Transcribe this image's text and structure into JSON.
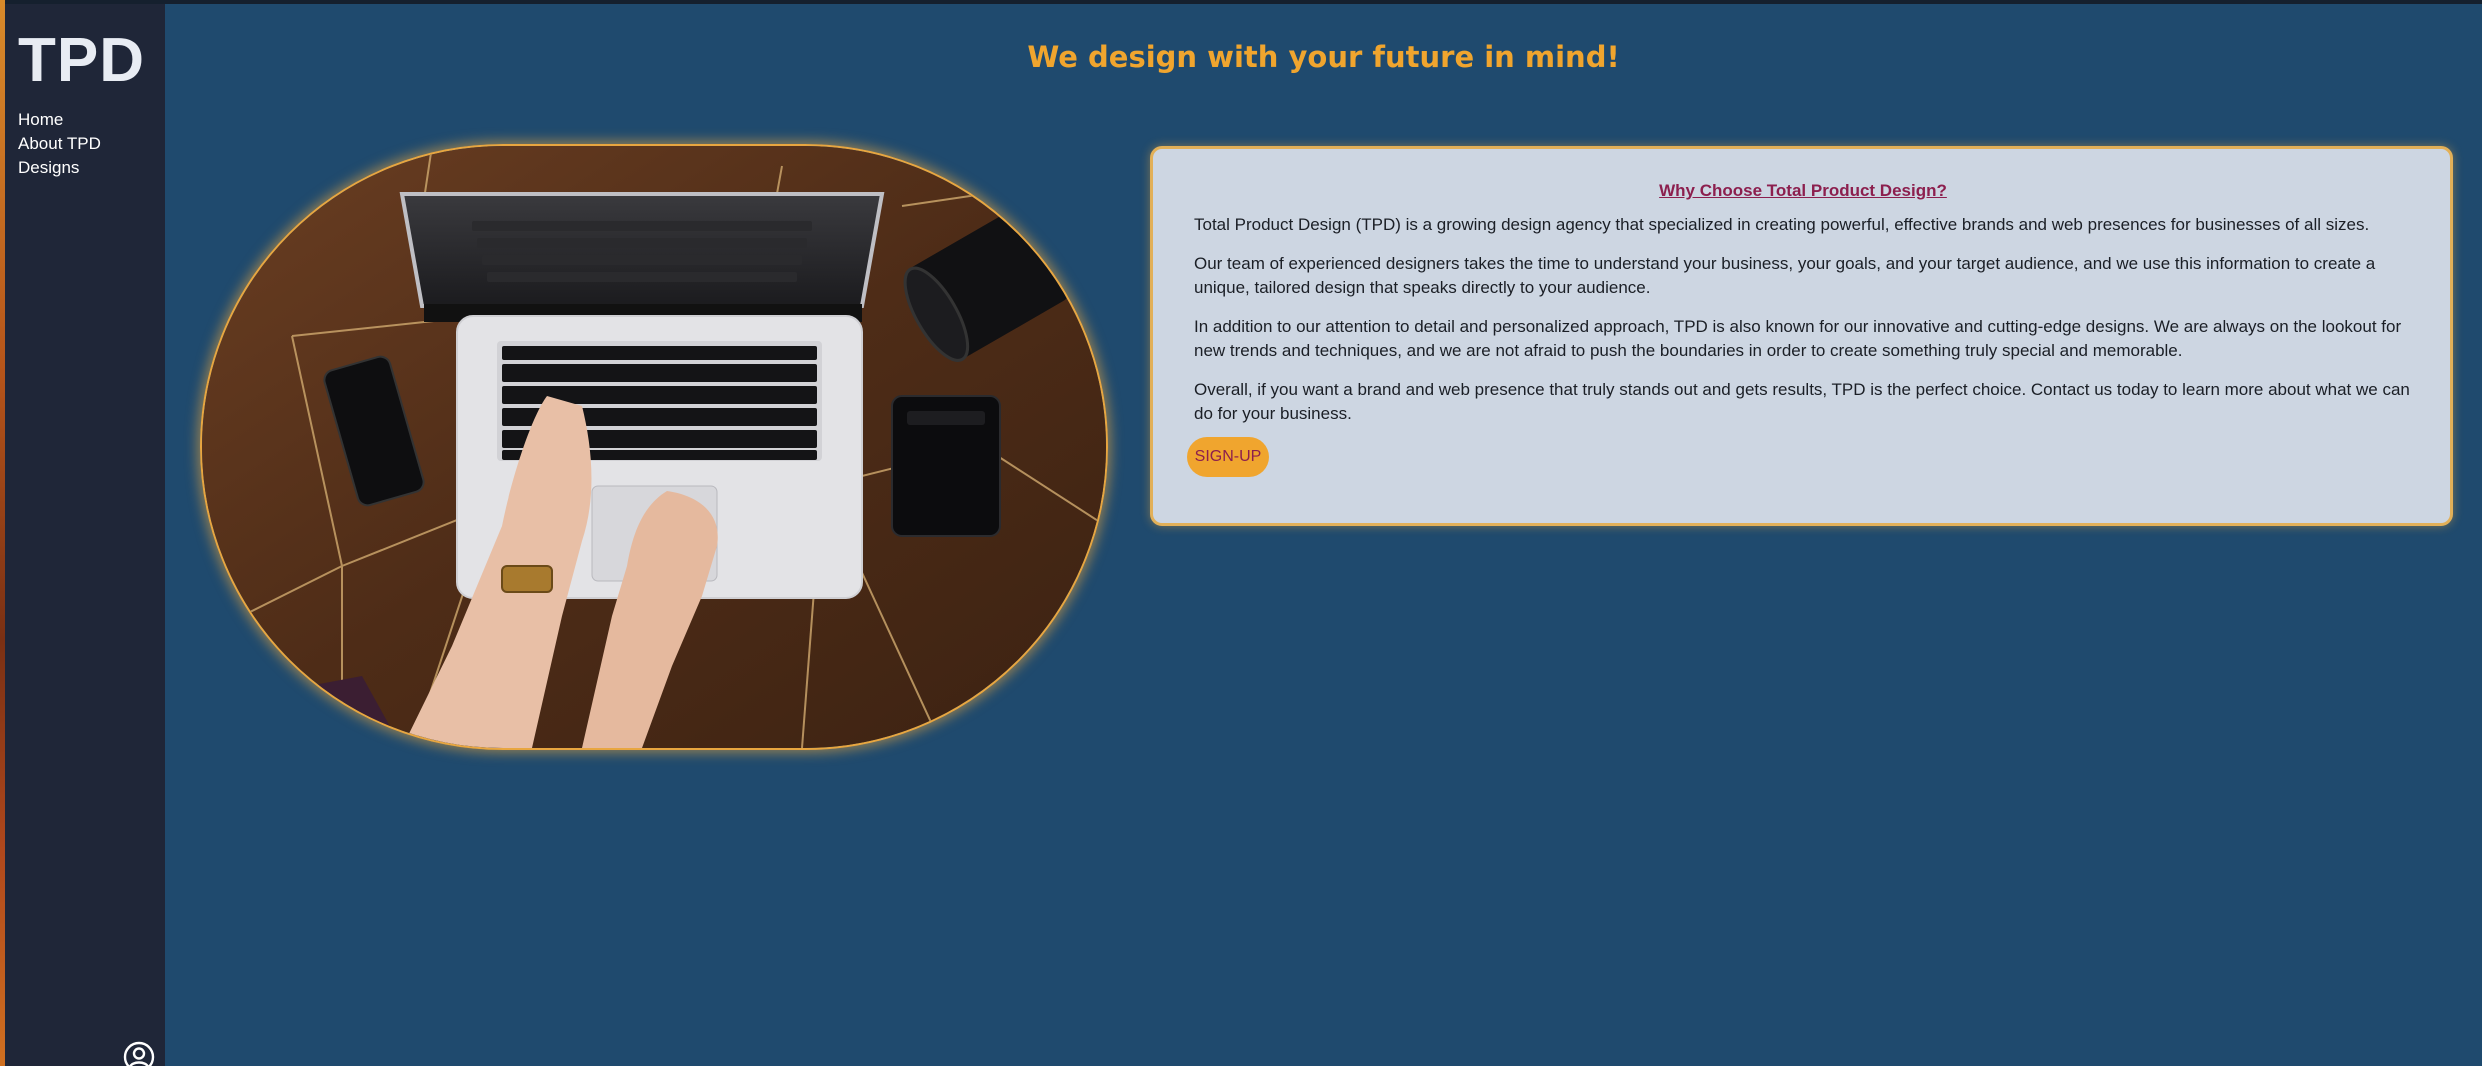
{
  "sidebar": {
    "logo": "TPD",
    "nav": [
      "Home",
      "About TPD",
      "Designs"
    ],
    "account_icon": "user-circle-icon"
  },
  "main": {
    "title": "We design with your future in mind!",
    "hero_image": "laptop-on-wooden-desk-photo"
  },
  "card": {
    "heading": "Why Choose Total Product Design?",
    "paragraphs": [
      "Total Product Design (TPD) is a growing design agency that specialized in creating powerful, effective brands and web presences for businesses of all sizes.",
      "Our team of experienced designers takes the time to understand your business, your goals, and your target audience, and we use this information to create a unique, tailored design that speaks directly to your audience.",
      "In addition to our attention to detail and personalized approach, TPD is also known for our innovative and cutting-edge designs. We are always on the lookout for new trends and techniques, and we are not afraid to push the boundaries in order to create something truly special and memorable.",
      "Overall, if you want a brand and web presence that truly stands out and gets results, TPD is the perfect choice. Contact us today to learn more about what we can do for your business."
    ],
    "button_label": "SIGN-UP"
  },
  "colors": {
    "page_bg": "#1f4a6e",
    "sidebar_bg": "#1f2638",
    "accent": "#f0a52e",
    "heading_link": "#8c1f4e",
    "card_bg": "#cdd6e2"
  }
}
